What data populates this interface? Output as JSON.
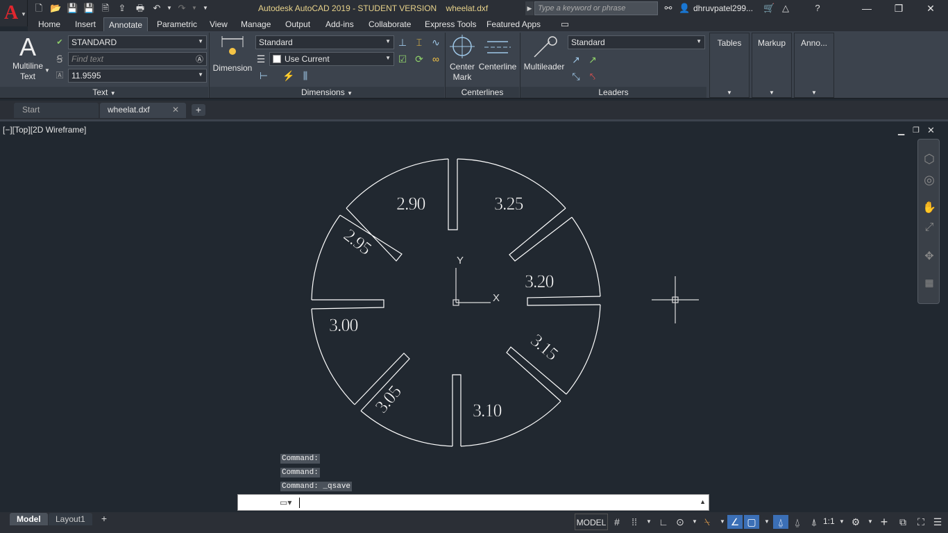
{
  "titlebar": {
    "title": "Autodesk AutoCAD 2019 - STUDENT VERSION    wheelat.dxf",
    "search_placeholder": "Type a keyword or phrase",
    "user": "dhruvpatel299..."
  },
  "menu_tabs": [
    "Home",
    "Insert",
    "Annotate",
    "Parametric",
    "View",
    "Manage",
    "Output",
    "Add-ins",
    "Collaborate",
    "Express Tools",
    "Featured Apps"
  ],
  "ribbon": {
    "text_panel": {
      "title": "Text",
      "multiline_label_1": "Multiline",
      "multiline_label_2": "Text",
      "style_value": "STANDARD",
      "find_placeholder": "Find text",
      "height_value": "11.9595"
    },
    "dimensions_panel": {
      "title": "Dimensions",
      "dimension_label": "Dimension",
      "dimstyle_value": "Standard",
      "layer_value": "Use Current"
    },
    "centerlines_panel": {
      "title": "Centerlines",
      "center_mark_1": "Center",
      "center_mark_2": "Mark",
      "centerline": "Centerline"
    },
    "leaders_panel": {
      "title": "Leaders",
      "multileader": "Multileader",
      "leader_style_value": "Standard"
    },
    "tables": "Tables",
    "markup": "Markup",
    "anno": "Anno..."
  },
  "doc_tabs": {
    "start": "Start",
    "active": "wheelat.dxf"
  },
  "viewport": {
    "label": "[−][Top][2D Wireframe]",
    "axis_y": "Y",
    "axis_x": "X",
    "segment_labels": [
      "2.90",
      "3.25",
      "2.95",
      "3.20",
      "3.00",
      "3.15",
      "3.05",
      "3.10"
    ]
  },
  "command_history": [
    "Command:",
    "Command:",
    "Command: _qsave"
  ],
  "layouts": [
    "Model",
    "Layout1"
  ],
  "status": {
    "model": "MODEL",
    "scale": "1:1"
  },
  "colors": {
    "accent": "#3c434d",
    "canvas": "#212830",
    "title_text": "#e8d38b"
  }
}
